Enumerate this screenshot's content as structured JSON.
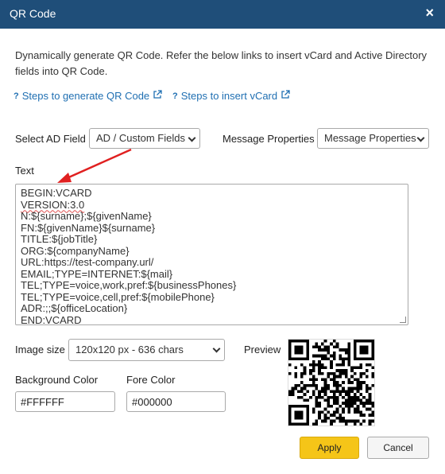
{
  "dialog": {
    "title": "QR Code",
    "close_symbol": "×"
  },
  "description": "Dynamically generate QR Code. Refer the below links to insert vCard and Active Directory fields into QR Code.",
  "links": {
    "generate": {
      "label": "Steps to generate QR Code",
      "icon": "help-icon"
    },
    "vcard": {
      "label": "Steps to insert vCard",
      "icon": "help-icon"
    }
  },
  "ad_field": {
    "label": "Select AD Field",
    "selected": "AD / Custom Fields"
  },
  "message_props": {
    "label": "Message Properties",
    "selected": "Message Properties"
  },
  "text_section": {
    "label": "Text",
    "lines": [
      "BEGIN:VCARD",
      "VERSION:3.0",
      "N:${surname};${givenName}",
      "FN:${givenName}${surname}",
      "TITLE:${jobTitle}",
      "ORG:${companyName}",
      "URL:https://test-company.url/",
      "EMAIL;TYPE=INTERNET:${mail}",
      "TEL;TYPE=voice,work,pref:${businessPhones}",
      "TEL;TYPE=voice,cell,pref:${mobilePhone}",
      "ADR:;;${officeLocation}",
      "END:VCARD"
    ]
  },
  "image_size": {
    "label": "Image size",
    "selected": "120x120 px - 636 chars"
  },
  "preview": {
    "label": "Preview"
  },
  "background_color": {
    "label": "Background Color",
    "value": "#FFFFFF"
  },
  "fore_color": {
    "label": "Fore Color",
    "value": "#000000"
  },
  "buttons": {
    "apply": "Apply",
    "cancel": "Cancel"
  },
  "colors": {
    "titlebar": "#1f4e79",
    "link": "#1f6fb2",
    "apply": "#f5c518",
    "arrow": "#e02020"
  }
}
